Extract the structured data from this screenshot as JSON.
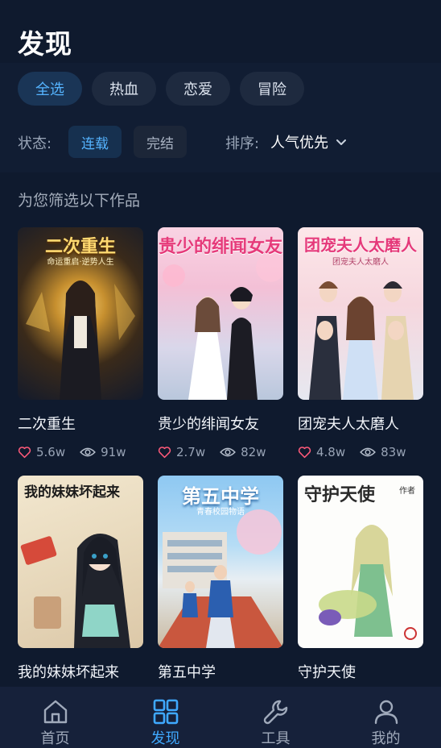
{
  "header": {
    "title": "发现"
  },
  "categories": [
    {
      "label": "全选",
      "active": true
    },
    {
      "label": "热血",
      "active": false
    },
    {
      "label": "恋爱",
      "active": false
    },
    {
      "label": "冒险",
      "active": false
    }
  ],
  "status": {
    "label": "状态:",
    "options": [
      {
        "label": "连载",
        "active": true
      },
      {
        "label": "完结",
        "active": false
      }
    ]
  },
  "sort": {
    "label": "排序:",
    "value": "人气优先"
  },
  "results_title": "为您筛选以下作品",
  "works": [
    {
      "title": "二次重生",
      "cover_title": "二次重生",
      "cover_subtitle": "命运重启·逆势人生",
      "likes": "5.6w",
      "views": "91w"
    },
    {
      "title": "贵少的绯闻女友",
      "cover_title": "贵少的绯闻女友",
      "cover_subtitle": "",
      "likes": "2.7w",
      "views": "82w"
    },
    {
      "title": "团宠夫人太磨人",
      "cover_title": "团宠夫人太磨人",
      "cover_subtitle": "团宠夫人太磨人",
      "likes": "4.8w",
      "views": "83w"
    },
    {
      "title": "我的妹妹坏起来",
      "cover_title": "我的妹妹坏起来",
      "cover_subtitle": "",
      "likes": "",
      "views": ""
    },
    {
      "title": "第五中学",
      "cover_title": "第五中学",
      "cover_subtitle": "青春校园物语",
      "likes": "",
      "views": ""
    },
    {
      "title": "守护天使",
      "cover_title": "守护天使",
      "cover_subtitle": "作者",
      "likes": "",
      "views": ""
    }
  ],
  "nav": [
    {
      "label": "首页",
      "icon": "home-icon",
      "active": false
    },
    {
      "label": "发现",
      "icon": "grid-icon",
      "active": true
    },
    {
      "label": "工具",
      "icon": "wrench-icon",
      "active": false
    },
    {
      "label": "我的",
      "icon": "user-icon",
      "active": false
    }
  ],
  "colors": {
    "background": "#0f1a2e",
    "accent": "#3fa9ff",
    "nav_bg": "#16213a"
  }
}
